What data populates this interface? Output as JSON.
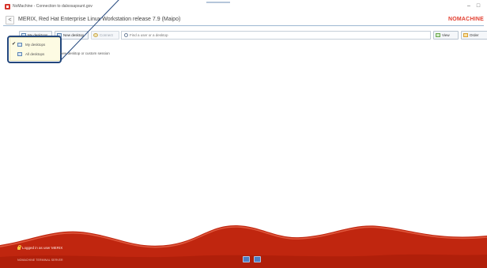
{
  "window": {
    "title": "NoMachine - Connection to dalxosapsunt.gov",
    "controls": {
      "minimize": "–",
      "maximize": "□"
    }
  },
  "header": {
    "back_symbol": "<",
    "server_title": "MERIX, Red Hat Enterprise Linux Workstation release 7.9 (Maipo)",
    "brand": "NOMACHINE"
  },
  "toolbar": {
    "my_desktops": "My desktops",
    "new_desktop": "New desktop",
    "connect": "Connect",
    "search_placeholder": "Find a user or a desktop",
    "view": "View",
    "order": "Order"
  },
  "dropdown": {
    "items": [
      {
        "label": "My desktops",
        "checked": true
      },
      {
        "label": "All desktops",
        "checked": false
      }
    ],
    "check_symbol": "✔"
  },
  "hint": "new desktop or custom session",
  "footer": {
    "logged_in": "Logged in as user MERIX",
    "copyright": "NOMACHINE TERMINAL SERVER"
  },
  "colors": {
    "brand_red": "#e23e2f",
    "footer_red": "#c0260f",
    "highlight": "#23477d"
  }
}
